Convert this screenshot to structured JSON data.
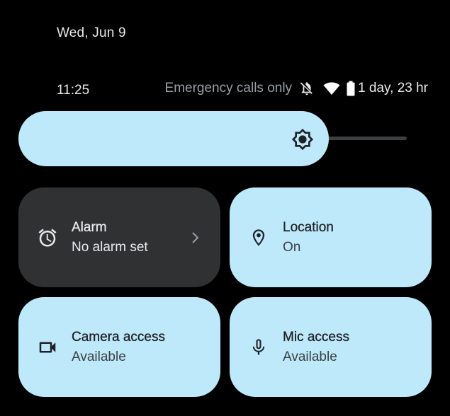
{
  "header": {
    "date": "Wed, Jun 9",
    "time": "11:25",
    "network_status": "Emergency calls only",
    "battery": "1 day, 23 hr",
    "icons": [
      "notifications-off-icon",
      "wifi-icon",
      "battery-icon"
    ]
  },
  "brightness": {
    "level": 0.8,
    "icon": "brightness-icon"
  },
  "tiles": [
    {
      "id": "alarm",
      "title": "Alarm",
      "subtitle": "No alarm set",
      "state": "off",
      "icon": "alarm-clock-icon",
      "has_chevron": true
    },
    {
      "id": "location",
      "title": "Location",
      "subtitle": "On",
      "state": "on",
      "icon": "location-pin-icon"
    },
    {
      "id": "camera",
      "title": "Camera access",
      "subtitle": "Available",
      "state": "on",
      "icon": "videocam-icon"
    },
    {
      "id": "mic",
      "title": "Mic access",
      "subtitle": "Available",
      "state": "on",
      "icon": "mic-icon"
    }
  ],
  "colors": {
    "background": "#000000",
    "tile_active": "#bde9fb",
    "tile_inactive": "#2f3133",
    "text_primary": "#e8eaed",
    "text_muted": "#9aa0a6"
  }
}
